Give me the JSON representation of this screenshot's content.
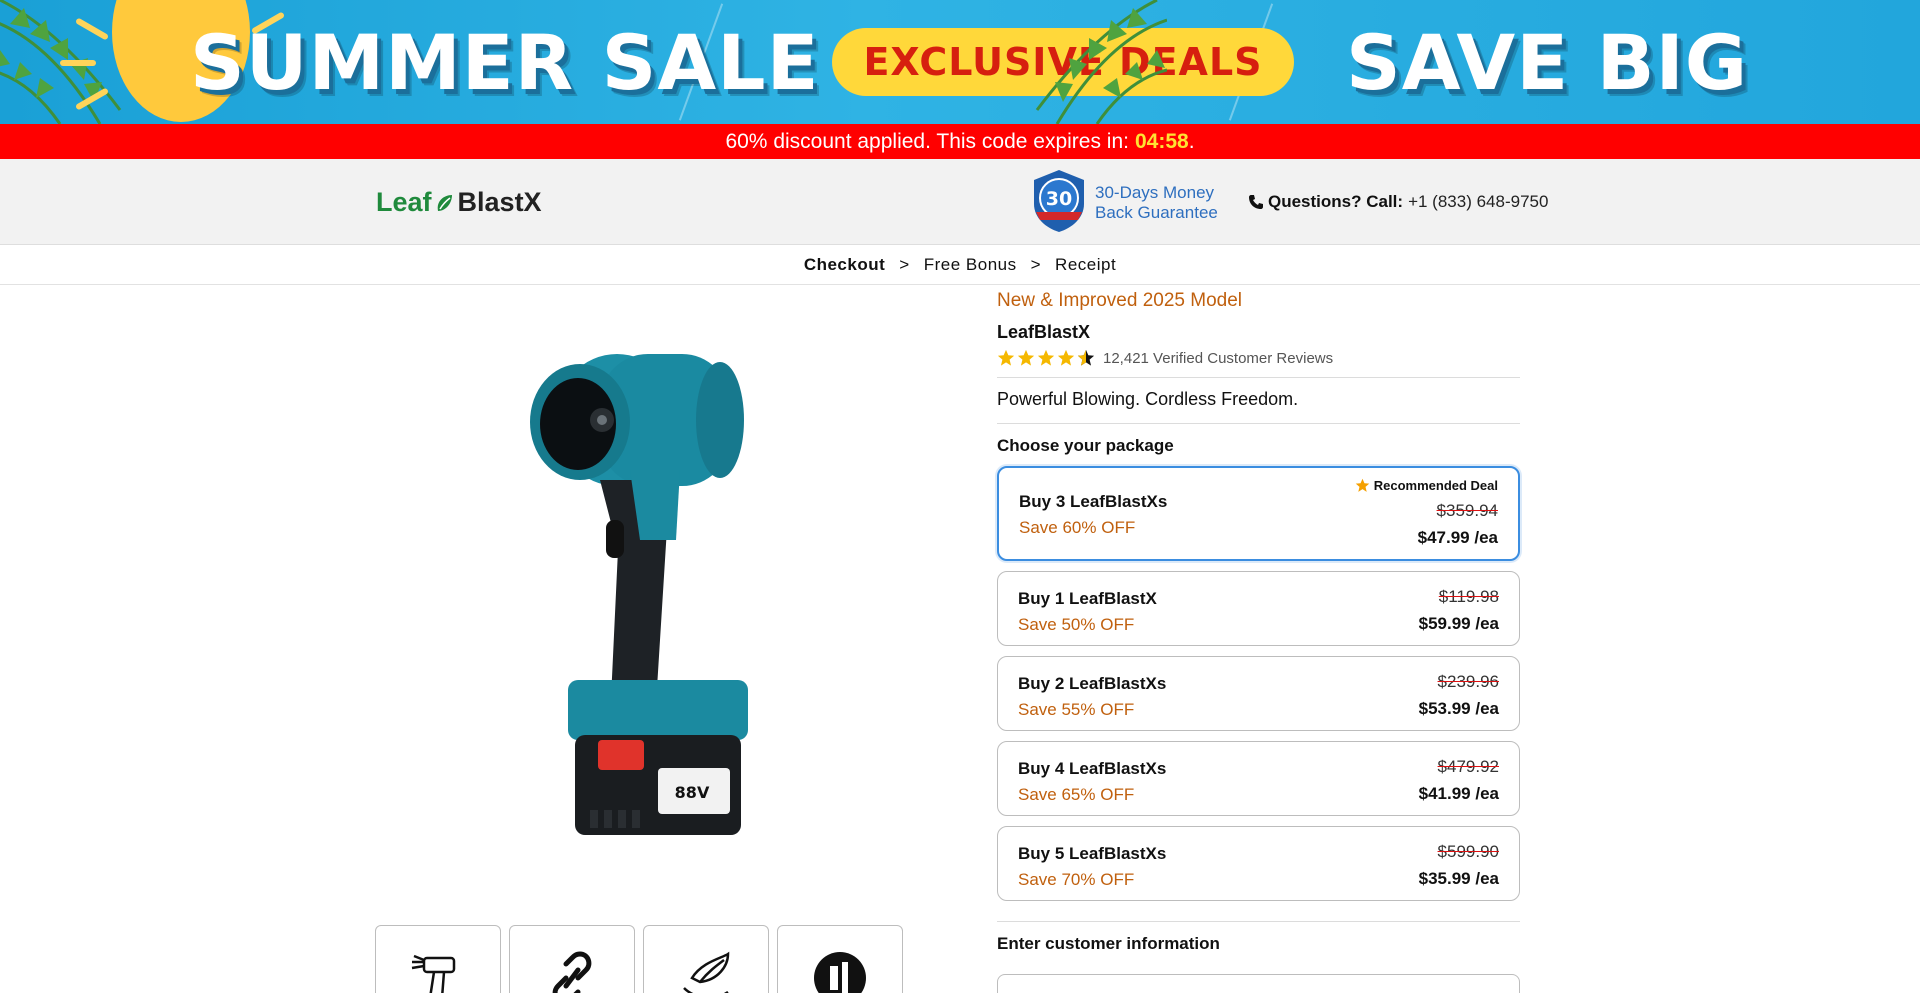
{
  "banner": {
    "left_text": "SUMMER SALE",
    "pill_text": "EXCLUSIVE DEALS",
    "right_text": "SAVE BIG"
  },
  "promo": {
    "message": "60% discount applied. This code expires in:",
    "timer": "04:58",
    "suffix": "."
  },
  "header": {
    "logo_part1": "Leaf",
    "logo_part2": "BlastX",
    "badge_number": "30",
    "guarantee_line1": "30-Days Money",
    "guarantee_line2": "Back Guarantee",
    "phone_label": "Questions? Call:",
    "phone_number": "+1 (833) 648-9750"
  },
  "breadcrumb": {
    "items": [
      "Checkout",
      "Free Bonus",
      "Receipt"
    ],
    "separator": ">"
  },
  "product": {
    "tag": "New & Improved 2025 Model",
    "name": "LeafBlastX",
    "rating": 4.5,
    "reviews": "12,421 Verified Customer Reviews",
    "tagline": "Powerful Blowing. Cordless Freedom.",
    "battery_label": "88V"
  },
  "packages": {
    "heading": "Choose your package",
    "recommended_label": "Recommended Deal",
    "items": [
      {
        "title": "Buy 3 LeafBlastXs",
        "save": "Save 60% OFF",
        "old": "$359.94",
        "price": "$47.99 /ea",
        "selected": true
      },
      {
        "title": "Buy 1 LeafBlastX",
        "save": "Save 50% OFF",
        "old": "$119.98",
        "price": "$59.99 /ea",
        "selected": false
      },
      {
        "title": "Buy 2 LeafBlastXs",
        "save": "Save 55% OFF",
        "old": "$239.96",
        "price": "$53.99 /ea",
        "selected": false
      },
      {
        "title": "Buy 4 LeafBlastXs",
        "save": "Save 65% OFF",
        "old": "$479.92",
        "price": "$41.99 /ea",
        "selected": false
      },
      {
        "title": "Buy 5 LeafBlastXs",
        "save": "Save 70% OFF",
        "old": "$599.90",
        "price": "$35.99 /ea",
        "selected": false
      }
    ]
  },
  "customer": {
    "heading": "Enter customer information"
  },
  "icons": [
    "phone-icon",
    "star-icon",
    "shield-badge-icon",
    "drill-icon",
    "chain-link-icon",
    "hand-leaf-icon",
    "sound-icon"
  ],
  "colors": {
    "accent_orange": "#c0600e",
    "promo_red": "#ff0000",
    "timer_yellow": "#ffe233",
    "selected_blue": "#3b8de0",
    "guarantee_blue": "#2e6fbf",
    "logo_green": "#1f8a3c"
  }
}
